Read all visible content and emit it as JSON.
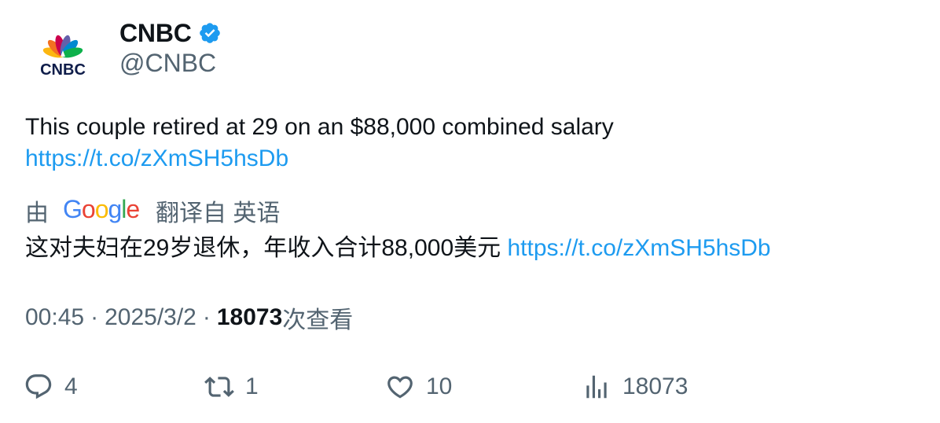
{
  "author": {
    "display_name": "CNBC",
    "handle": "@CNBC",
    "avatar_logo_text": "CNBC",
    "verified_icon": "verified-badge-icon"
  },
  "tweet": {
    "text": "This couple retired at 29 on an $88,000 combined salary",
    "link": "https://t.co/zXmSH5hsDb"
  },
  "translation": {
    "prefix": "由",
    "provider": "Google",
    "suffix": "翻译自 英语",
    "text": "这对夫妇在29岁退休，年收入合计88,000美元",
    "link": "https://t.co/zXmSH5hsDb"
  },
  "meta": {
    "time": "00:45",
    "separator": "·",
    "date": "2025/3/2",
    "views_count": "18073",
    "views_label": "次查看"
  },
  "actions": {
    "reply_count": "4",
    "retweet_count": "1",
    "like_count": "10",
    "views_count": "18073"
  },
  "colors": {
    "link": "#1d9bf0",
    "text_primary": "#0f1419",
    "text_secondary": "#536471",
    "verified": "#1d9bf0"
  }
}
